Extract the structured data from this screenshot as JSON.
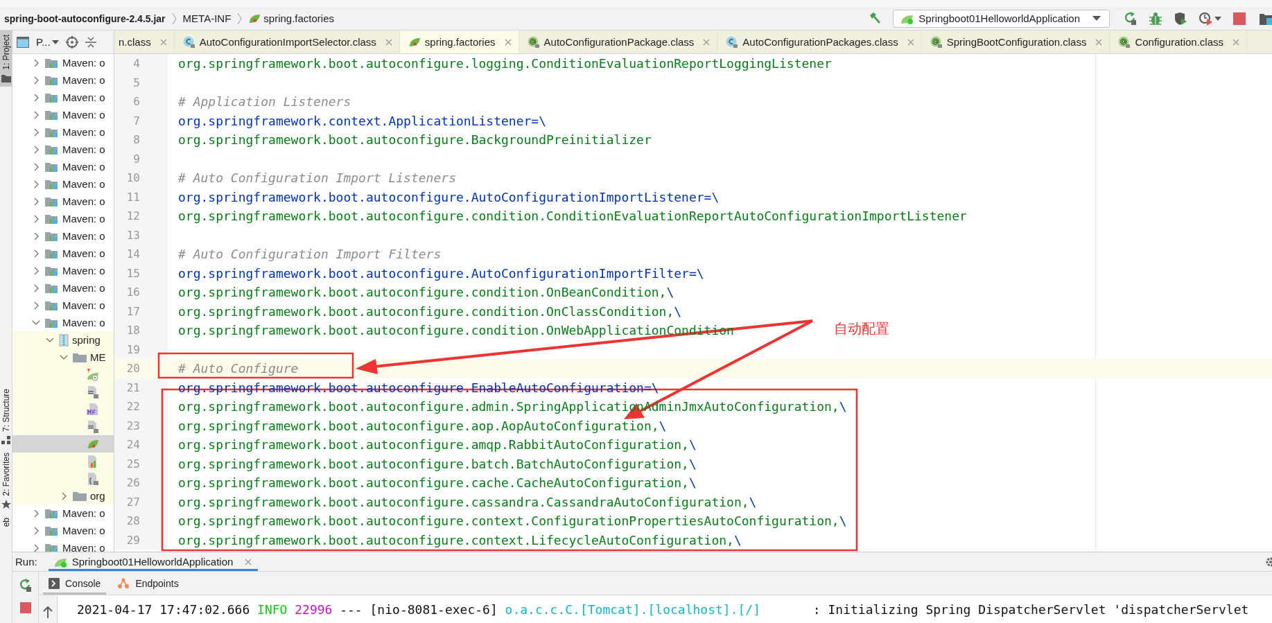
{
  "breadcrumb": [
    {
      "label": "spring-boot-autoconfigure-2.4.5.jar",
      "kind": "archive",
      "bold": true
    },
    {
      "label": "META-INF",
      "kind": "folder",
      "bold": false
    },
    {
      "label": "spring.factories",
      "kind": "file",
      "bold": false
    }
  ],
  "toolbar": {
    "run_config": "Springboot01HelloworldApplication"
  },
  "tool_strip": [
    {
      "label": "1: Project",
      "selected": true,
      "kind": "project"
    },
    {
      "label": "7: Structure",
      "selected": false,
      "kind": "structure"
    },
    {
      "label": "2: Favorites",
      "selected": false,
      "kind": "favorites"
    },
    {
      "label": "eb",
      "selected": false,
      "kind": "web"
    }
  ],
  "project": {
    "title": "P...",
    "tree": [
      {
        "label": "Maven: o",
        "kind": "library",
        "expanded": false
      },
      {
        "label": "Maven: o",
        "kind": "library",
        "expanded": false
      },
      {
        "label": "Maven: o",
        "kind": "library",
        "expanded": false
      },
      {
        "label": "Maven: o",
        "kind": "library",
        "expanded": false
      },
      {
        "label": "Maven: o",
        "kind": "library",
        "expanded": false
      },
      {
        "label": "Maven: o",
        "kind": "library",
        "expanded": false
      },
      {
        "label": "Maven: o",
        "kind": "library",
        "expanded": false
      },
      {
        "label": "Maven: o",
        "kind": "library",
        "expanded": false
      },
      {
        "label": "Maven: o",
        "kind": "library",
        "expanded": false
      },
      {
        "label": "Maven: o",
        "kind": "library",
        "expanded": false
      },
      {
        "label": "Maven: o",
        "kind": "library",
        "expanded": false
      },
      {
        "label": "Maven: o",
        "kind": "library",
        "expanded": false
      },
      {
        "label": "Maven: o",
        "kind": "library",
        "expanded": false
      },
      {
        "label": "Maven: o",
        "kind": "library",
        "expanded": false
      },
      {
        "label": "Maven: o",
        "kind": "library",
        "expanded": false
      },
      {
        "label": "Maven: o",
        "kind": "library",
        "expanded": true,
        "children": [
          {
            "label": "spring",
            "kind": "jar",
            "expanded": true,
            "highlighted": true,
            "children": [
              {
                "label": "ME",
                "kind": "folder",
                "expanded": true,
                "highlighted": true,
                "children": [
                  {
                    "kind": "spring-config",
                    "highlighted": true,
                    "selected": false
                  },
                  {
                    "kind": "text",
                    "highlighted": true,
                    "selected": false
                  },
                  {
                    "kind": "manifest",
                    "highlighted": true,
                    "selected": false
                  },
                  {
                    "kind": "text",
                    "highlighted": true,
                    "selected": false
                  },
                  {
                    "kind": "factories",
                    "highlighted": true,
                    "selected": true
                  },
                  {
                    "kind": "chart",
                    "highlighted": true,
                    "selected": false
                  },
                  {
                    "kind": "json",
                    "highlighted": true,
                    "selected": false
                  }
                ]
              },
              {
                "label": "org",
                "kind": "folder",
                "expanded": false,
                "highlighted": true
              }
            ]
          }
        ]
      },
      {
        "label": "Maven: o",
        "kind": "library",
        "expanded": false
      },
      {
        "label": "Maven: o",
        "kind": "library",
        "expanded": false
      },
      {
        "label": "Maven: o",
        "kind": "library",
        "expanded": false
      }
    ]
  },
  "tabs": [
    {
      "label": "n.class",
      "selected": false
    },
    {
      "label": "AutoConfigurationImportSelector.class",
      "kind": "class",
      "selected": false
    },
    {
      "label": "spring.factories",
      "kind": "spring",
      "selected": true
    },
    {
      "label": "AutoConfigurationPackage.class",
      "kind": "annotation",
      "selected": false
    },
    {
      "label": "AutoConfigurationPackages.class",
      "kind": "class",
      "selected": false
    },
    {
      "label": "SpringBootConfiguration.class",
      "kind": "annotation",
      "selected": false
    },
    {
      "label": "Configuration.class",
      "kind": "annotation",
      "selected": false
    }
  ],
  "code": [
    {
      "number": "4",
      "kind": "value",
      "text": "org.springframework.boot.autoconfigure.logging.ConditionEvaluationReportLoggingListener"
    },
    {
      "number": "5"
    },
    {
      "number": "6",
      "kind": "comment",
      "text": "# Application Listeners"
    },
    {
      "number": "7",
      "kind": "key",
      "text": "org.springframework.context.ApplicationListener=",
      "escape": "\\"
    },
    {
      "number": "8",
      "kind": "value",
      "text": "org.springframework.boot.autoconfigure.BackgroundPreinitializer"
    },
    {
      "number": "9"
    },
    {
      "number": "10",
      "kind": "comment",
      "text": "# Auto Configuration Import Listeners"
    },
    {
      "number": "11",
      "kind": "key",
      "text": "org.springframework.boot.autoconfigure.AutoConfigurationImportListener=",
      "escape": "\\"
    },
    {
      "number": "12",
      "kind": "value",
      "text": "org.springframework.boot.autoconfigure.condition.ConditionEvaluationReportAutoConfigurationImportListener"
    },
    {
      "number": "13"
    },
    {
      "number": "14",
      "kind": "comment",
      "text": "# Auto Configuration Import Filters"
    },
    {
      "number": "15",
      "kind": "key",
      "text": "org.springframework.boot.autoconfigure.AutoConfigurationImportFilter=",
      "escape": "\\"
    },
    {
      "number": "16",
      "kind": "value",
      "text": "org.springframework.boot.autoconfigure.condition.OnBeanCondition,",
      "escape": "\\"
    },
    {
      "number": "17",
      "kind": "value",
      "text": "org.springframework.boot.autoconfigure.condition.OnClassCondition,",
      "escape": "\\"
    },
    {
      "number": "18",
      "kind": "value",
      "text": "org.springframework.boot.autoconfigure.condition.OnWebApplicationCondition"
    },
    {
      "number": "19"
    },
    {
      "number": "20",
      "kind": "comment",
      "text": "# Auto Configure",
      "current": true
    },
    {
      "number": "21",
      "kind": "key",
      "text": "org.springframework.boot.autoconfigure.EnableAutoConfiguration=",
      "escape": "\\"
    },
    {
      "number": "22",
      "kind": "value",
      "text": "org.springframework.boot.autoconfigure.admin.SpringApplicationAdminJmxAutoConfiguration,",
      "escape": "\\"
    },
    {
      "number": "23",
      "kind": "value",
      "text": "org.springframework.boot.autoconfigure.aop.AopAutoConfiguration,",
      "escape": "\\"
    },
    {
      "number": "24",
      "kind": "value",
      "text": "org.springframework.boot.autoconfigure.amqp.RabbitAutoConfiguration,",
      "escape": "\\"
    },
    {
      "number": "25",
      "kind": "value",
      "text": "org.springframework.boot.autoconfigure.batch.BatchAutoConfiguration,",
      "escape": "\\"
    },
    {
      "number": "26",
      "kind": "value",
      "text": "org.springframework.boot.autoconfigure.cache.CacheAutoConfiguration,",
      "escape": "\\"
    },
    {
      "number": "27",
      "kind": "value",
      "text": "org.springframework.boot.autoconfigure.cassandra.CassandraAutoConfiguration,",
      "escape": "\\"
    },
    {
      "number": "28",
      "kind": "value",
      "text": "org.springframework.boot.autoconfigure.context.ConfigurationPropertiesAutoConfiguration,",
      "escape": "\\"
    },
    {
      "number": "29",
      "kind": "value",
      "text": "org.springframework.boot.autoconfigure.context.LifecycleAutoConfiguration,",
      "escape": "\\"
    }
  ],
  "annotation": {
    "label": "自动配置"
  },
  "run": {
    "label": "Run:",
    "tab": "Springboot01HelloworldApplication",
    "console_tabs": [
      {
        "label": "Console",
        "kind": "console",
        "selected": true
      },
      {
        "label": "Endpoints",
        "kind": "endpoints",
        "selected": false
      }
    ],
    "log": [
      {
        "kind": "time",
        "text": "2021-04-17 17:47:02.666"
      },
      {
        "kind": "level",
        "text": "INFO"
      },
      {
        "kind": "pid",
        "text": "22996"
      },
      {
        "kind": "plain",
        "text": "--- [nio-8081-exec-6]"
      },
      {
        "kind": "logger",
        "text": "o.a.c.c.C.[Tomcat].[localhost].[/]"
      },
      {
        "kind": "message",
        "text": ": Initializing Spring DispatcherServlet 'dispatcherServlet"
      }
    ]
  }
}
